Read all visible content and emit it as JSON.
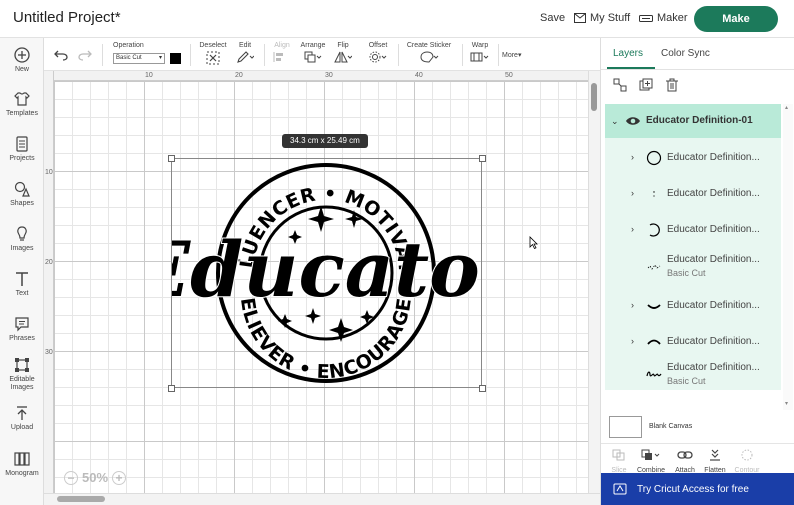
{
  "header": {
    "title": "Untitled Project*",
    "save_label": "Save",
    "mystuff_label": "My Stuff",
    "maker_label": "Maker",
    "make_label": "Make"
  },
  "sidebar": {
    "items": [
      {
        "label": "New",
        "icon": "plus-circle-icon"
      },
      {
        "label": "Templates",
        "icon": "shirt-icon"
      },
      {
        "label": "Projects",
        "icon": "projects-icon"
      },
      {
        "label": "Shapes",
        "icon": "shapes-icon"
      },
      {
        "label": "Images",
        "icon": "lightbulb-icon"
      },
      {
        "label": "Text",
        "icon": "text-icon"
      },
      {
        "label": "Phrases",
        "icon": "speech-bubble-icon"
      },
      {
        "label": "Editable Images",
        "icon": "editable-images-icon"
      },
      {
        "label": "Upload",
        "icon": "upload-icon"
      },
      {
        "label": "Monogram",
        "icon": "monogram-icon"
      }
    ]
  },
  "toolbar": {
    "operation_label": "Operation",
    "operation_value": "Basic Cut",
    "operation_color": "#000000",
    "deselect_label": "Deselect",
    "edit_label": "Edit",
    "align_label": "Align",
    "arrange_label": "Arrange",
    "flip_label": "Flip",
    "offset_label": "Offset",
    "create_sticker_label": "Create Sticker",
    "warp_label": "Warp",
    "more_label": "More"
  },
  "canvas": {
    "ruler_top": [
      "10",
      "20",
      "30",
      "40",
      "50"
    ],
    "ruler_left": [
      "10",
      "20",
      "30"
    ],
    "size_badge": "34.3  cm x 25.49  cm",
    "zoom_level": "50%",
    "design_words": {
      "top": "INFLUENCER • MOTIVATOR",
      "center": "Educator",
      "bottom": "BELIEVER • ENCOURAGER"
    }
  },
  "right_panel": {
    "tabs": [
      {
        "label": "Layers",
        "active": true
      },
      {
        "label": "Color Sync",
        "active": false
      }
    ],
    "group_name": "Educator Definition-01",
    "layers": [
      {
        "name": "Educator Definition...",
        "sub": "",
        "has_chevron": true
      },
      {
        "name": "Educator Definition...",
        "sub": "",
        "has_chevron": true
      },
      {
        "name": "Educator Definition...",
        "sub": "",
        "has_chevron": true
      },
      {
        "name": "Educator Definition...",
        "sub": "Basic Cut",
        "has_chevron": false
      },
      {
        "name": "Educator Definition...",
        "sub": "",
        "has_chevron": true
      },
      {
        "name": "Educator Definition...",
        "sub": "",
        "has_chevron": true
      },
      {
        "name": "Educator Definition...",
        "sub": "Basic Cut",
        "has_chevron": false
      }
    ],
    "blank_canvas_label": "Blank Canvas",
    "bottom_tools": [
      {
        "label": "Slice",
        "enabled": false
      },
      {
        "label": "Combine",
        "enabled": true
      },
      {
        "label": "Attach",
        "enabled": true
      },
      {
        "label": "Flatten",
        "enabled": true
      },
      {
        "label": "Contour",
        "enabled": false
      }
    ],
    "cta_label": "Try Cricut Access for free"
  },
  "colors": {
    "accent": "#1c7a5b",
    "layer_group_bg": "#b9ead8",
    "layer_list_bg": "#e8f7f1",
    "cta_bg": "#1a3ea8"
  }
}
